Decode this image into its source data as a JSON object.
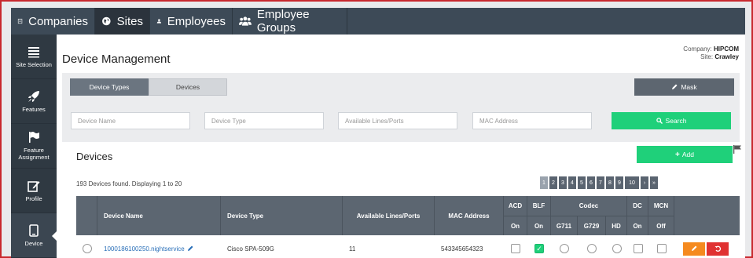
{
  "tabs": [
    {
      "label": "Companies",
      "icon": "building-icon",
      "active": false
    },
    {
      "label": "Sites",
      "icon": "globe-icon",
      "active": true
    },
    {
      "label": "Employees",
      "icon": "user-icon",
      "active": false
    },
    {
      "label": "Employee Groups",
      "icon": "users-icon",
      "active": false
    }
  ],
  "sidebar": {
    "items": [
      {
        "label": "Site Selection",
        "icon": "list-icon"
      },
      {
        "label": "Features",
        "icon": "rocket-icon"
      },
      {
        "label": "Feature Assignment",
        "icon": "flag-icon"
      },
      {
        "label": "Profile",
        "icon": "edit-icon"
      },
      {
        "label": "Device",
        "icon": "device-icon",
        "active": true
      }
    ]
  },
  "header": {
    "title": "Device Management",
    "company_label": "Company:",
    "company_value": "HIPCOM",
    "site_label": "Site:",
    "site_value": "Crawley"
  },
  "toolbar": {
    "device_types_label": "Device Types",
    "devices_label": "Devices",
    "mask_label": "Mask"
  },
  "search": {
    "device_name_placeholder": "Device Name",
    "device_type_placeholder": "Device Type",
    "available_lines_placeholder": "Available Lines/Ports",
    "mac_address_placeholder": "MAC Address",
    "search_label": "Search"
  },
  "devices": {
    "title": "Devices",
    "add_label": "Add",
    "count_text": "193 Devices found. Displaying 1 to 20",
    "pagination": [
      "1",
      "2",
      "3",
      "4",
      "5",
      "6",
      "7",
      "8",
      "9",
      "10",
      "›",
      "»"
    ],
    "current_page": "1"
  },
  "table": {
    "headers": {
      "device_name": "Device Name",
      "device_type": "Device Type",
      "available_lines": "Available Lines/Ports",
      "mac_address": "MAC Address",
      "acd": "ACD",
      "blf": "BLF",
      "codec": "Codec",
      "dc": "DC",
      "mcn": "MCN"
    },
    "subheaders": {
      "acd": "On",
      "blf": "On",
      "g711": "G711",
      "g729": "G729",
      "hd": "HD",
      "dc": "On",
      "mcn": "Off"
    },
    "rows": [
      {
        "device_name": "1000186100250.nightservice",
        "device_type": "Cisco SPA-509G",
        "available_lines": "11",
        "mac_address": "543345654323",
        "acd": false,
        "blf": true
      }
    ]
  },
  "colors": {
    "accent_green": "#1fd07a",
    "nav_dark": "#2f3942",
    "edit_orange": "#f58a1f",
    "delete_red": "#e03232",
    "frame_red": "#c8282d"
  }
}
